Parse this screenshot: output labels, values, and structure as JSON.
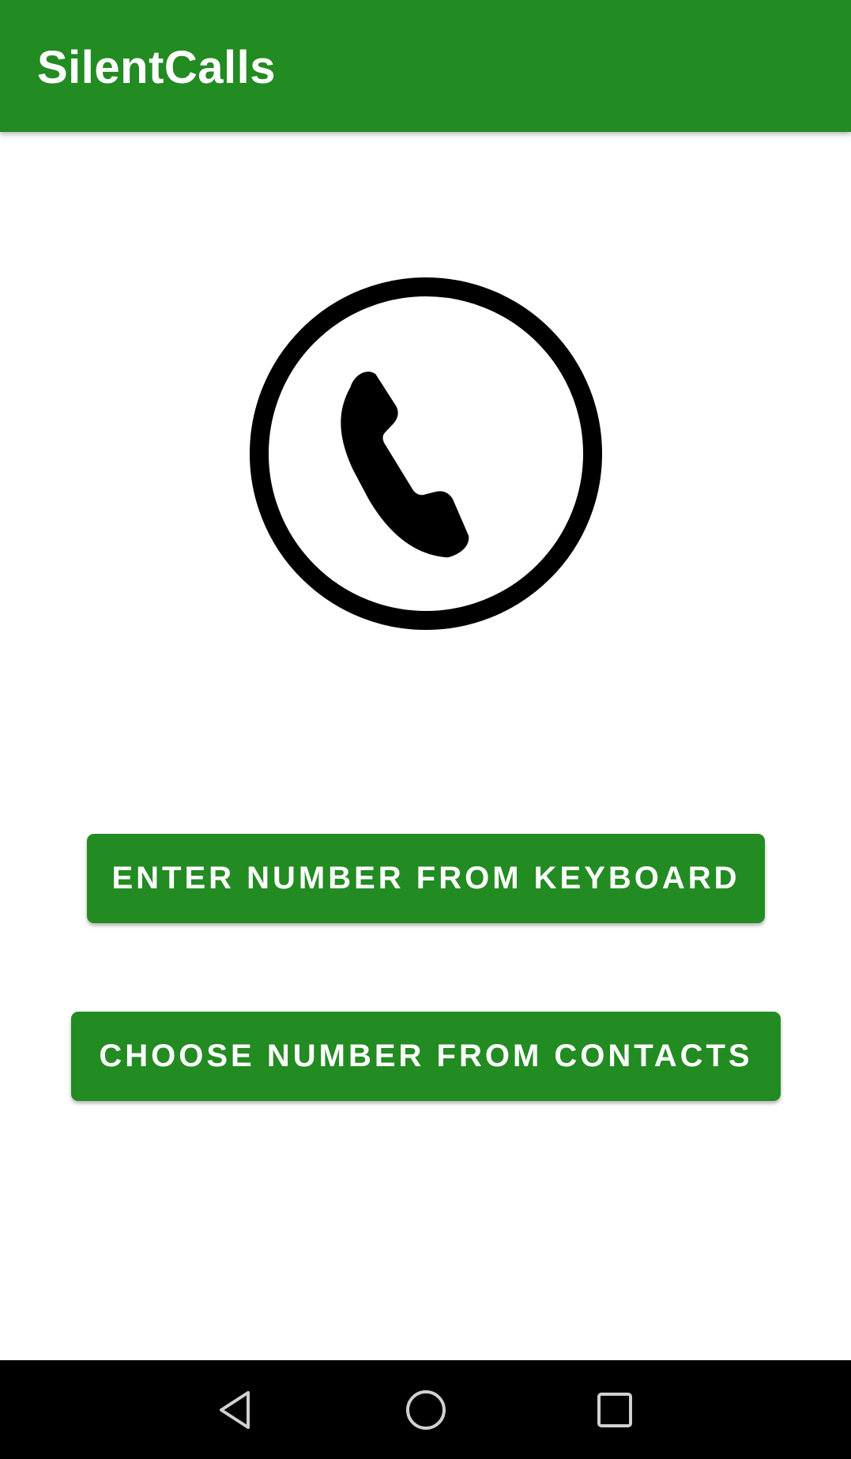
{
  "app_bar": {
    "title": "SilentCalls",
    "background_color": "#228b22"
  },
  "main": {
    "logo_icon": "phone-in-circle-icon",
    "buttons": {
      "enter_from_keyboard": "ENTER NUMBER FROM KEYBOARD",
      "choose_from_contacts": "CHOOSE NUMBER FROM CONTACTS"
    },
    "button_color": "#228b22"
  },
  "navigation_bar": {
    "back_icon": "back-triangle-icon",
    "home_icon": "home-circle-icon",
    "recents_icon": "recents-square-icon"
  }
}
